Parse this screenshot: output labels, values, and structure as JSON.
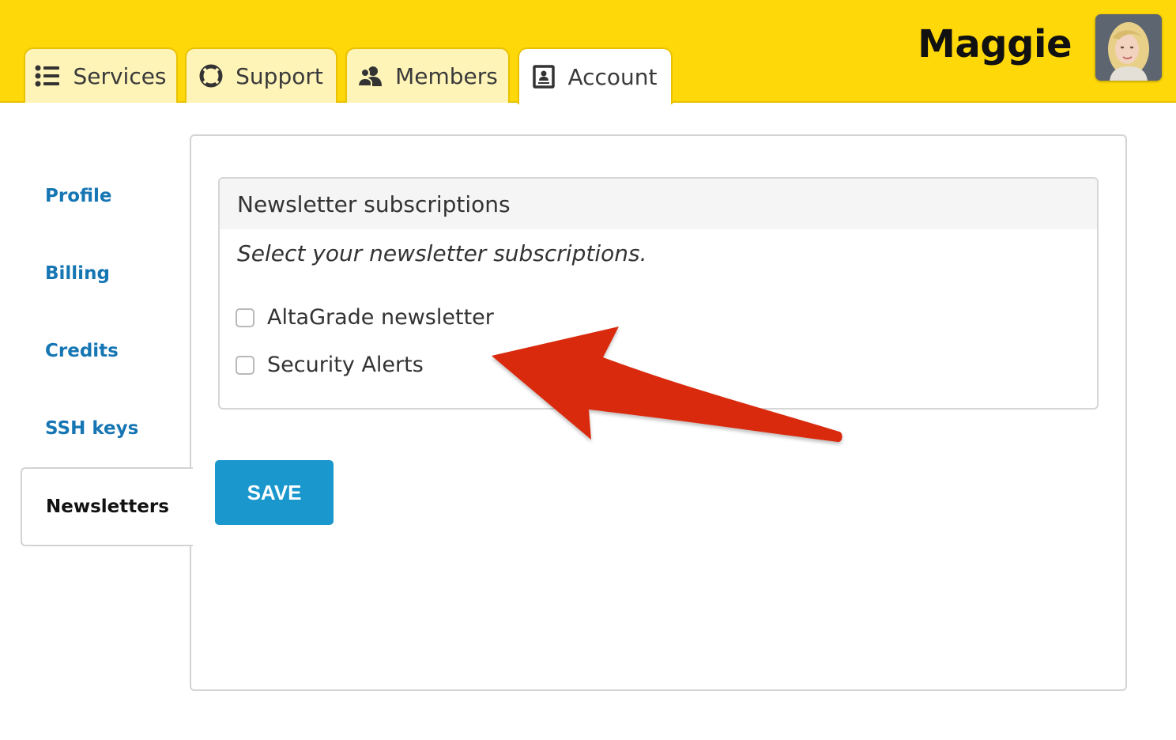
{
  "header": {
    "tabs": [
      {
        "label": "Services",
        "icon": "list-icon"
      },
      {
        "label": "Support",
        "icon": "lifebuoy-icon"
      },
      {
        "label": "Members",
        "icon": "users-icon"
      },
      {
        "label": "Account",
        "icon": "id-card-icon"
      }
    ],
    "active_tab": "Account",
    "username": "Maggie",
    "colors": {
      "header_bg": "#ffd809",
      "tab_bg": "#fff4b8",
      "link": "#1676b4",
      "button": "#1a97cc",
      "arrow": "#d92b10"
    }
  },
  "sidenav": {
    "items": [
      {
        "label": "Profile"
      },
      {
        "label": "Billing"
      },
      {
        "label": "Credits"
      },
      {
        "label": "SSH keys"
      },
      {
        "label": "Newsletters"
      }
    ],
    "active_item": "Newsletters"
  },
  "newsletters": {
    "title": "Newsletter subscriptions",
    "description": "Select your newsletter subscriptions.",
    "options": [
      {
        "label": "AltaGrade newsletter",
        "checked": false
      },
      {
        "label": "Security Alerts",
        "checked": false
      }
    ],
    "save_label": "SAVE"
  }
}
